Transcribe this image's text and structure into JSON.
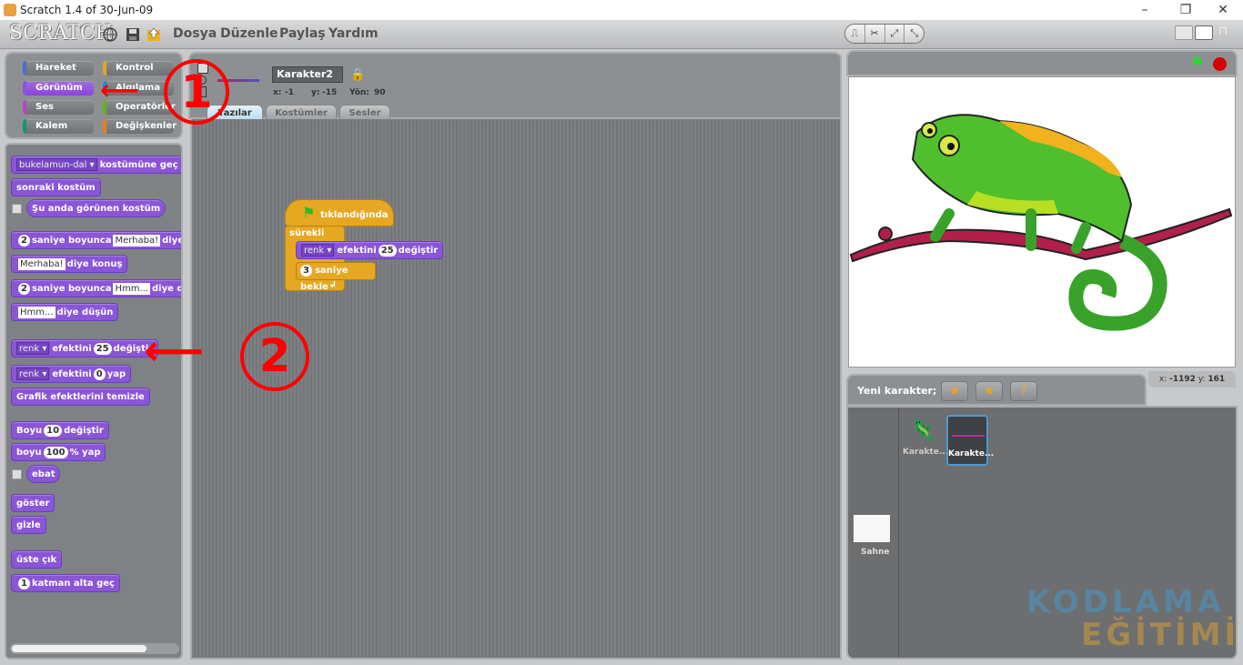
{
  "window": {
    "title": "Scratch 1.4 of 30-Jun-09",
    "controls": {
      "minimize": "–",
      "maximize": "❐",
      "close": "✕"
    }
  },
  "menubar": {
    "logo": "SCRATCH",
    "icons": [
      "globe-icon",
      "save-icon",
      "share-icon"
    ],
    "menus": [
      "Dosya",
      "Düzenle",
      "Paylaş",
      "Yardım"
    ],
    "tools": [
      "stamp-icon",
      "scissors-icon",
      "grow-icon",
      "shrink-icon"
    ],
    "view_modes": [
      "small-stage-icon",
      "normal-stage-icon",
      "presentation-icon"
    ]
  },
  "categories": [
    {
      "label": "Hareket",
      "color": "#4a6cd4",
      "selected": false
    },
    {
      "label": "Kontrol",
      "color": "#e1a91a",
      "selected": false
    },
    {
      "label": "Görünüm",
      "color": "#8a55d7",
      "selected": true
    },
    {
      "label": "Algılama",
      "color": "#0093db",
      "selected": false
    },
    {
      "label": "Ses",
      "color": "#bb42c3",
      "selected": false
    },
    {
      "label": "Operatörler",
      "color": "#5cb712",
      "selected": false
    },
    {
      "label": "Kalem",
      "color": "#0e9a6c",
      "selected": false
    },
    {
      "label": "Değişkenler",
      "color": "#ee7d16",
      "selected": false
    }
  ],
  "palette": {
    "b1_dropdown": "bukelamun-dal",
    "b1_text": "kostümüne geç",
    "b2": "sonraki kostüm",
    "b3": "Şu anda görünen kostüm",
    "b4_num": "2",
    "b4_t1": "saniye boyunca",
    "b4_input": "Merhaba!",
    "b4_t2": "diye konuş",
    "b5_input": "Merhaba!",
    "b5_t": "diye konuş",
    "b6_num": "2",
    "b6_t1": "saniye boyunca",
    "b6_input": "Hmm...",
    "b6_t2": "diye düşün",
    "b7_input": "Hmm...",
    "b7_t": "diye düşün",
    "b8_dropdown": "renk",
    "b8_t1": "efektini",
    "b8_num": "25",
    "b8_t2": "değiştir",
    "b9_dropdown": "renk",
    "b9_t1": "efektini",
    "b9_num": "0",
    "b9_t2": "yap",
    "b10": "Grafik efektlerini temizle",
    "b11_t1": "Boyu",
    "b11_num": "10",
    "b11_t2": "değiştir",
    "b12_t1": "boyu",
    "b12_num": "100",
    "b12_t2": "% yap",
    "b13": "ebat",
    "b14": "göster",
    "b15": "gizle",
    "b16": "üste çık",
    "b17_num": "1",
    "b17_t": "katman alta geç"
  },
  "sprite": {
    "name": "Karakter2",
    "x_label": "x:",
    "x": "-1",
    "y_label": "y:",
    "y": "-15",
    "dir_label": "Yön:",
    "dir": "90",
    "tabs": [
      {
        "label": "Yazılar",
        "selected": true
      },
      {
        "label": "Kostümler",
        "selected": false
      },
      {
        "label": "Sesler",
        "selected": false
      }
    ]
  },
  "script": {
    "hat": "tıklandığında",
    "forever": "sürekli",
    "effect_dropdown": "renk",
    "effect_t1": "efektini",
    "effect_num": "25",
    "effect_t2": "değiştir",
    "wait_num": "3",
    "wait_t": "saniye bekle"
  },
  "stage": {
    "mouse_x_label": "x:",
    "mouse_x": "-1192",
    "mouse_y_label": "y:",
    "mouse_y": "161"
  },
  "new_sprite": {
    "label": "Yeni karakter;",
    "buttons": [
      "paint-sprite-icon",
      "choose-sprite-icon",
      "random-sprite-icon"
    ]
  },
  "sprites": [
    {
      "name": "Karakte...",
      "selected": false
    },
    {
      "name": "Karakte...",
      "selected": true
    }
  ],
  "stage_thumb": {
    "label": "Sahne"
  },
  "annotations": {
    "one": "1",
    "two": "2"
  },
  "watermark": {
    "line1": "KODLAMA",
    "line2": "EĞİTİMİ"
  }
}
